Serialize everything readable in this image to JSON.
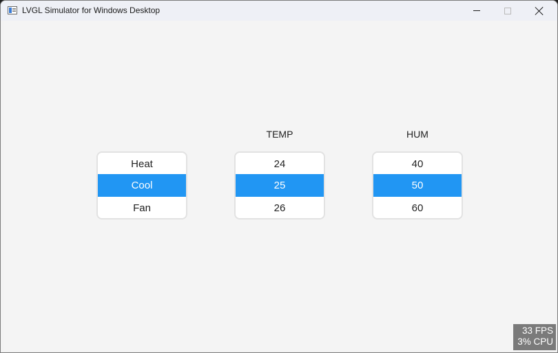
{
  "window": {
    "title": "LVGL Simulator for Windows Desktop"
  },
  "controls": {
    "minimize": "minimize-icon",
    "maximize": "maximize-icon",
    "close": "close-icon"
  },
  "rollers": [
    {
      "label": "",
      "options": [
        "Heat",
        "Cool",
        "Fan"
      ],
      "selected": "Cool"
    },
    {
      "label": "TEMP",
      "options": [
        "24",
        "25",
        "26"
      ],
      "selected": "25"
    },
    {
      "label": "HUM",
      "options": [
        "40",
        "50",
        "60"
      ],
      "selected": "50"
    }
  ],
  "perf": {
    "fps": "33 FPS",
    "cpu": "3% CPU"
  },
  "colors": {
    "accent": "#2196f3",
    "background": "#f4f4f4",
    "perf_bg": "#7a7a7a"
  }
}
